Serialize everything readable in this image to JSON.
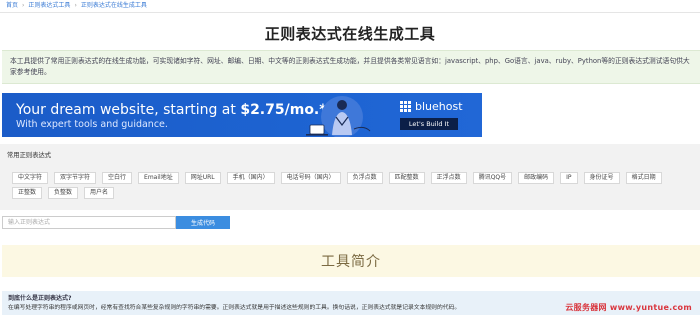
{
  "breadcrumb": [
    "首页",
    "正则表达式工具",
    "正则表达式在线生成工具"
  ],
  "breadcrumb_sep": "›",
  "page_title": "正则表达式在线生成工具",
  "intro_text": "本工具提供了常用正则表达式的在线生成功能，可实现诸如字符、网址、邮编、日期、中文等的正则表达式生成功能，并且提供各类常见语言如：javascript、php、Go语言、java、ruby、Python等的正则表达式测试语句供大家参考使用。",
  "ad": {
    "headline_prefix": "Your dream website, starting at ",
    "headline_price": "$2.75/mo.*",
    "subline": "With expert tools and guidance.",
    "brand": "bluehost",
    "cta": "Let's Build It"
  },
  "common": {
    "title": "常用正则表达式",
    "tags": [
      "中文字符",
      "双字节字符",
      "空白行",
      "Email地址",
      "网址URL",
      "手机（国内）",
      "电话号码（国内）",
      "负浮点数",
      "匹配整数",
      "正浮点数",
      "腾讯QQ号",
      "邮政编码",
      "IP",
      "身份证号",
      "格式日期",
      "正整数",
      "负整数",
      "用户名"
    ]
  },
  "generator": {
    "placeholder": "输入正则表达式",
    "button": "生成代码"
  },
  "section_title": "工具简介",
  "faq": {
    "question": "到底什么是正则表达式?",
    "answer": "在编写处理字符串的程序或网页时，经常有查找符合某些复杂规则的字符串的需要。正则表达式就是用于描述这些规则的工具。换句话说，正则表达式就是记录文本规则的代码。"
  },
  "watermark": "云服务器网 www.yuntue.com",
  "colors": {
    "accent": "#3b8de0",
    "ad_blue": "#1d63d1",
    "intro_bg": "#eef6e8",
    "band_bg": "#fcf8e3",
    "faq_bg": "#e8f1f9"
  }
}
